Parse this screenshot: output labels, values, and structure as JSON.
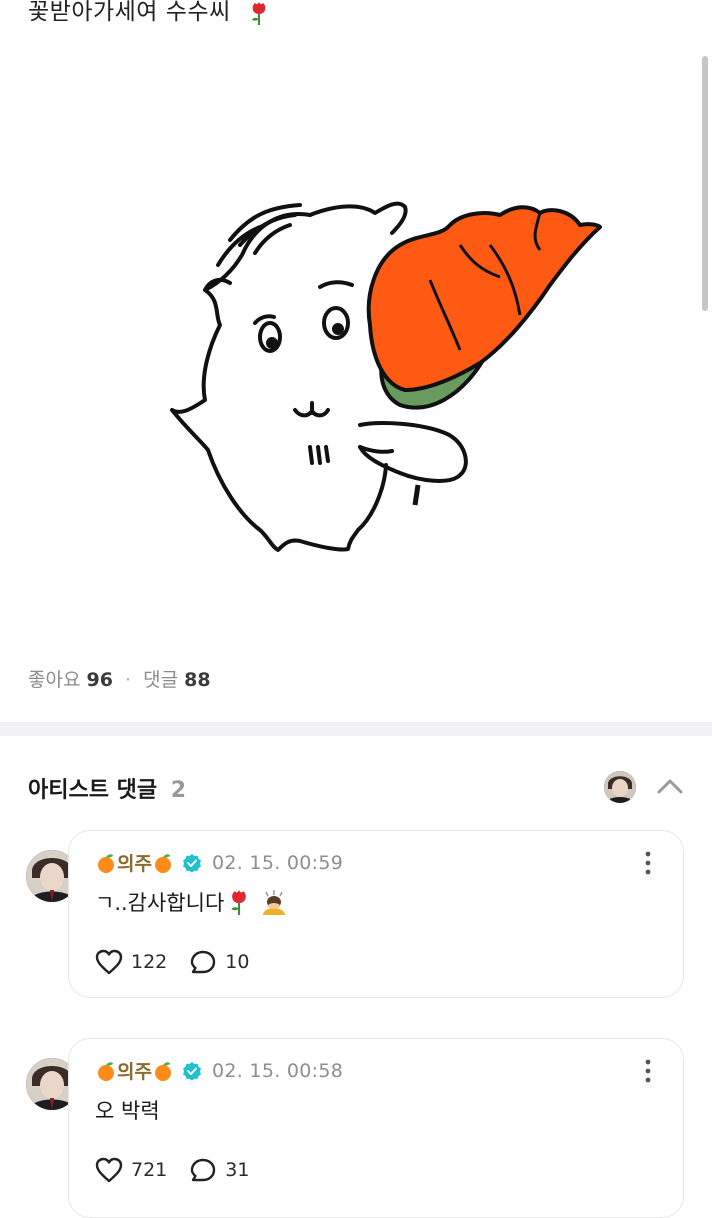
{
  "post": {
    "caption": "꽃받아가세여 수수씨",
    "caption_emoji": "rose",
    "likes_label": "좋아요",
    "likes_count": "96",
    "separator": "·",
    "comments_label": "댓글",
    "comments_count": "88"
  },
  "artist_comments": {
    "header": "아티스트 댓글",
    "count": "2"
  },
  "comments": [
    {
      "author": "의주",
      "timestamp": "02. 15. 00:59",
      "text": "ㄱ..감사합니다",
      "emojis": [
        "rose",
        "bowing-person"
      ],
      "likes": "122",
      "replies": "10"
    },
    {
      "author": "의주",
      "timestamp": "02. 15. 00:58",
      "text": "오 박력",
      "emojis": [],
      "likes": "721",
      "replies": "31"
    }
  ],
  "colors": {
    "author_gold": "#8a6d2c",
    "verified_teal": "#1ec2cf",
    "rose_orange": "#ff5a14",
    "stem_green": "#6a9b5e"
  }
}
